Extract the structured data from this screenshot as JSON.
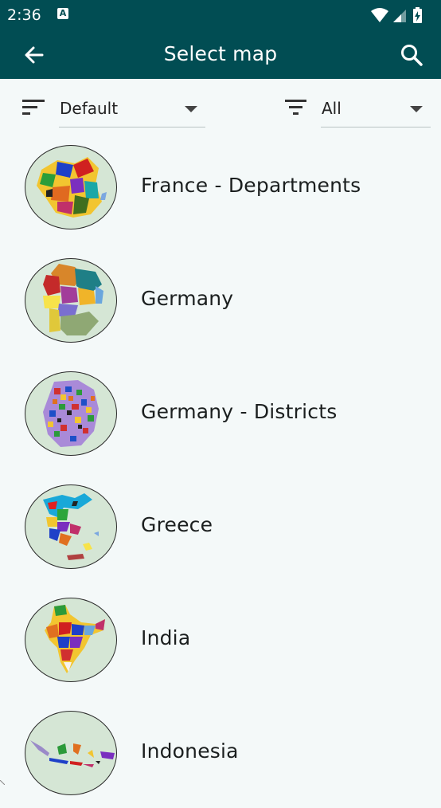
{
  "status_bar": {
    "time": "2:36",
    "notification_icon": "a-icon",
    "wifi_icon": "wifi-icon",
    "signal_icon": "signal-icon",
    "battery_icon": "battery-charging-icon"
  },
  "app_bar": {
    "title": "Select map",
    "back_icon": "arrow-back-icon",
    "search_icon": "search-icon"
  },
  "filters": {
    "sort": {
      "icon": "sort-icon",
      "value": "Default"
    },
    "filter": {
      "icon": "filter-icon",
      "value": "All"
    }
  },
  "maps": [
    {
      "name": "France - Departments"
    },
    {
      "name": "Germany"
    },
    {
      "name": "Germany - Districts"
    },
    {
      "name": "Greece"
    },
    {
      "name": "India"
    },
    {
      "name": "Indonesia"
    }
  ],
  "colors": {
    "primary": "#014d53",
    "background": "#f4f9f9",
    "thumb_background": "#d5e6d5"
  }
}
